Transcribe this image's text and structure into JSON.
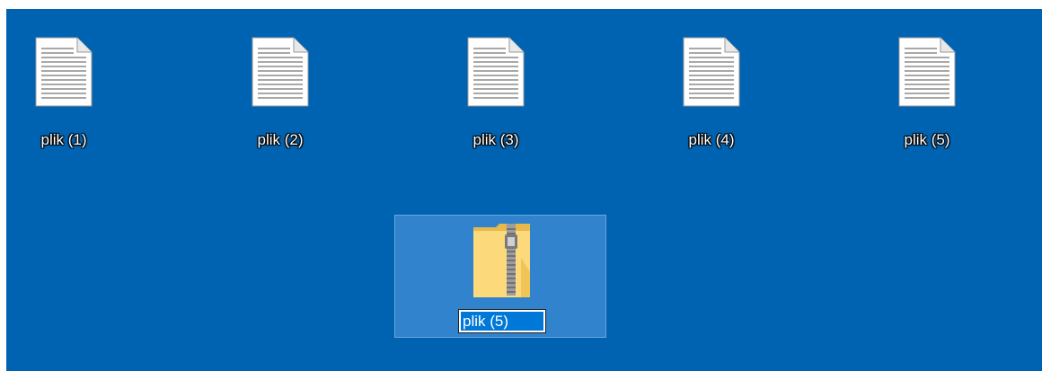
{
  "desktop": {
    "background_color": "#0063B1",
    "icons": [
      {
        "label": "plik (1)",
        "type": "text-file-icon"
      },
      {
        "label": "plik (2)",
        "type": "text-file-icon"
      },
      {
        "label": "plik (3)",
        "type": "text-file-icon"
      },
      {
        "label": "plik (4)",
        "type": "text-file-icon"
      },
      {
        "label": "plik (5)",
        "type": "text-file-icon"
      }
    ],
    "selected_item": {
      "type": "zip-folder-icon",
      "rename_value": "plik (5)",
      "selection_color": "#0078D7"
    }
  }
}
